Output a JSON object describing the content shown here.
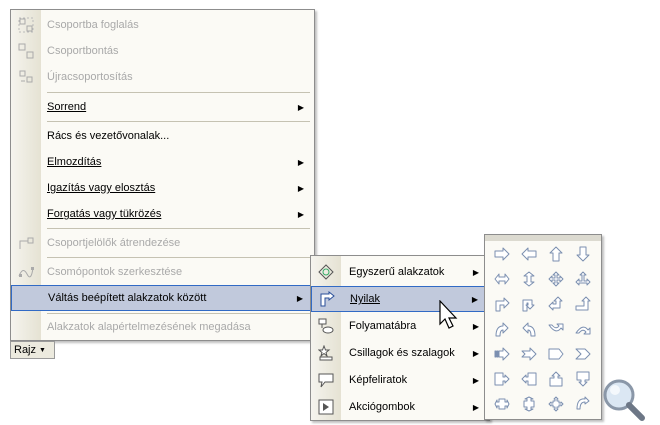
{
  "main_menu": {
    "items": [
      {
        "label": "Csoportba foglalás",
        "disabled": true,
        "icon": "group-icon"
      },
      {
        "label": "Csoportbontás",
        "disabled": true,
        "icon": "ungroup-icon"
      },
      {
        "label": "Újracsoportosítás",
        "disabled": true,
        "icon": "regroup-icon"
      },
      {
        "label": "Sorrend",
        "disabled": false,
        "submenu": true
      },
      {
        "label": "Rács és vezetővonalak...",
        "disabled": false
      },
      {
        "label": "Elmozdítás",
        "disabled": false,
        "submenu": true
      },
      {
        "label": "Igazítás vagy elosztás",
        "disabled": false,
        "submenu": true
      },
      {
        "label": "Forgatás vagy tükrözés",
        "disabled": false,
        "submenu": true
      },
      {
        "label": "Csoportjelölők átrendezése",
        "disabled": true,
        "icon": "reroute-icon"
      },
      {
        "label": "Csomópontok szerkesztése",
        "disabled": true,
        "icon": "edit-points-icon"
      },
      {
        "label": "Váltás beépített alakzatok között",
        "disabled": false,
        "submenu": true,
        "highlighted": true
      },
      {
        "label": "Alakzatok alapértelmezésének megadása",
        "disabled": true
      }
    ]
  },
  "sub_menu": {
    "items": [
      {
        "label": "Egyszerű alakzatok",
        "icon": "basic-shapes-icon"
      },
      {
        "label": "Nyilak",
        "icon": "block-arrows-icon",
        "highlighted": true
      },
      {
        "label": "Folyamatábra",
        "icon": "flowchart-icon"
      },
      {
        "label": "Csillagok és szalagok",
        "icon": "stars-banners-icon"
      },
      {
        "label": "Képfeliratok",
        "icon": "callouts-icon"
      },
      {
        "label": "Akciógombok",
        "icon": "action-buttons-icon"
      }
    ]
  },
  "arrows_panel": {
    "shapes": [
      "right-arrow-icon",
      "left-arrow-icon",
      "up-arrow-icon",
      "down-arrow-icon",
      "left-right-arrow-icon",
      "up-down-arrow-icon",
      "quad-arrow-icon",
      "left-right-up-arrow-icon",
      "bent-arrow-icon",
      "u-turn-arrow-icon",
      "left-up-arrow-icon",
      "bent-up-arrow-icon",
      "curved-right-arrow-icon",
      "curved-left-arrow-icon",
      "curved-up-arrow-icon",
      "curved-down-arrow-icon",
      "striped-right-arrow-icon",
      "notched-right-arrow-icon",
      "pentagon-icon",
      "chevron-icon",
      "right-arrow-callout-icon",
      "left-arrow-callout-icon",
      "up-arrow-callout-icon",
      "down-arrow-callout-icon",
      "left-right-arrow-callout-icon",
      "up-down-arrow-callout-icon",
      "quad-arrow-callout-icon",
      "circular-arrow-icon"
    ]
  },
  "draw_button": {
    "label": "Rajz"
  },
  "colors": {
    "highlight": "#c1c9dc",
    "highlight_border": "#316ac5",
    "shape_stroke": "#7b8fb0"
  }
}
